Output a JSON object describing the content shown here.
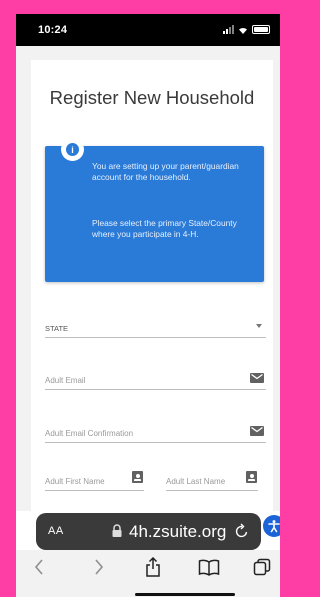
{
  "status_bar": {
    "time": "10:24"
  },
  "page": {
    "title": "Register New Household",
    "info": {
      "paragraph_1": "You are setting up your parent/guardian account for the household.",
      "paragraph_2": "Please select the primary State/County where you participate in 4-H."
    },
    "form": {
      "state_label": "STATE",
      "adult_email_placeholder": "Adult Email",
      "adult_email_confirmation_placeholder": "Adult Email Confirmation",
      "adult_first_name_placeholder": "Adult First Name",
      "adult_last_name_placeholder": "Adult Last Name"
    }
  },
  "browser": {
    "text_size_label": "AA",
    "url": "4h.zsuite.org"
  },
  "colors": {
    "frame_background": "#ff3ea5",
    "info_box": "#2a7ad8",
    "accessibility_button": "#1b63d6"
  },
  "icons": [
    "info-icon",
    "dropdown-caret-icon",
    "mail-icon",
    "contact-card-icon",
    "accessibility-icon",
    "lock-icon",
    "reload-icon",
    "back-icon",
    "forward-icon",
    "share-icon",
    "bookmarks-icon",
    "tabs-icon"
  ]
}
